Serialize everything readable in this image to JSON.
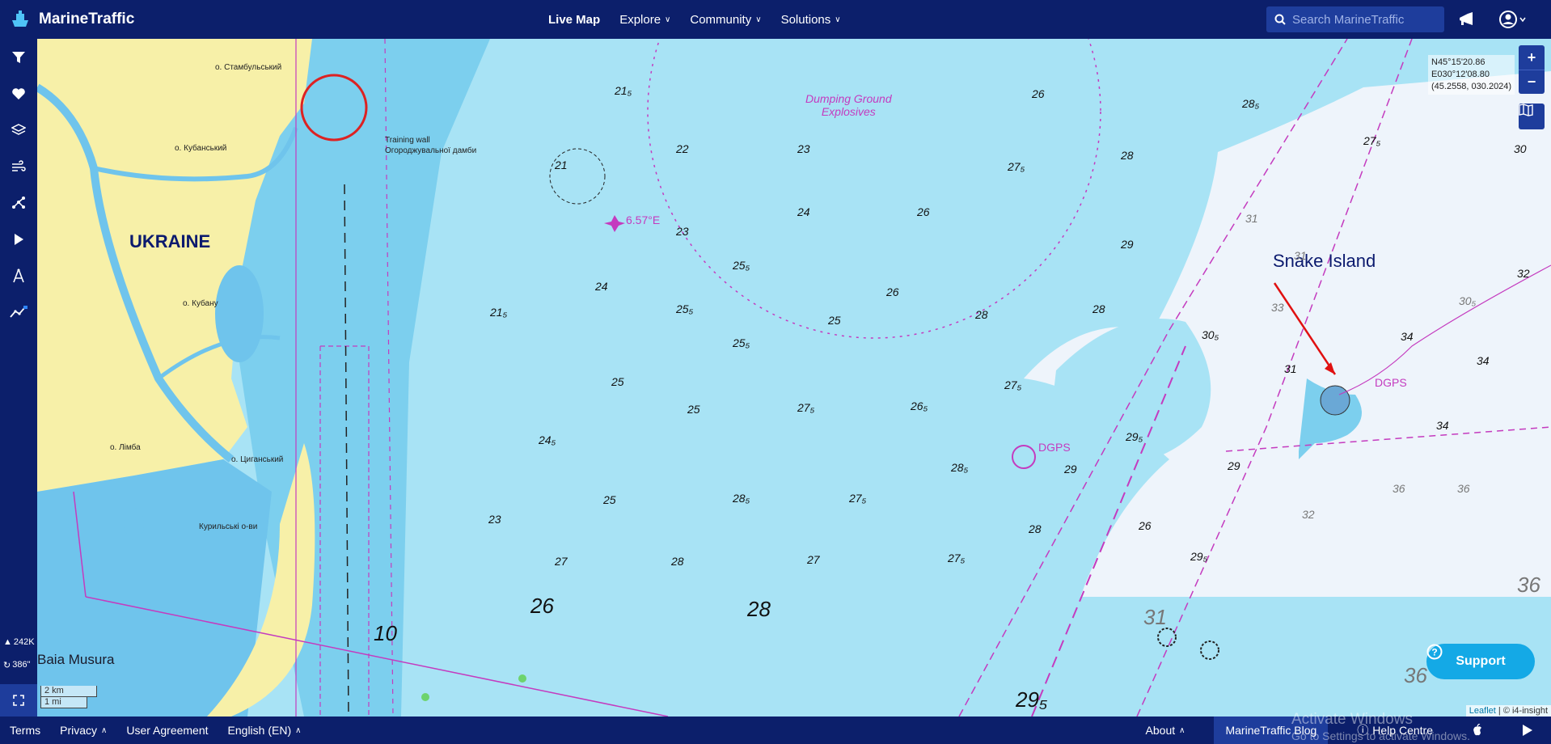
{
  "header": {
    "brand": "MarineTraffic",
    "nav": [
      {
        "label": "Live Map",
        "active": true,
        "dropdown": false
      },
      {
        "label": "Explore",
        "active": false,
        "dropdown": true
      },
      {
        "label": "Community",
        "active": false,
        "dropdown": true
      },
      {
        "label": "Solutions",
        "active": false,
        "dropdown": true
      }
    ],
    "search_placeholder": "Search MarineTraffic",
    "icons": [
      "megaphone-icon",
      "user-account-icon"
    ]
  },
  "sidebar": {
    "items": [
      "filter-icon",
      "favorites-heart-icon",
      "layers-icon",
      "wind-icon",
      "routes-icon",
      "play-icon",
      "measure-icon",
      "analytics-icon"
    ],
    "vessel_count": "242K",
    "refresh_interval": "386\""
  },
  "map": {
    "coords_line1": "N45°15'20.86",
    "coords_line2": "E030°12'08.80",
    "coords_line3": "(45.2558, 030.2024)",
    "zoom_in": "+",
    "zoom_out": "−",
    "labels": {
      "country": "UKRAINE",
      "island": "Snake Island",
      "baia": "Baia Musura",
      "dumping": "Dumping Ground\nExplosives",
      "magvar": "6.57°E",
      "dgps": "DGPS"
    },
    "places": [
      {
        "text": "о. Стамбульський"
      },
      {
        "text": "о. Кубанський"
      },
      {
        "text": "о. Кубану"
      },
      {
        "text": "о. Лімба"
      },
      {
        "text": "о. Циганський"
      },
      {
        "text": "Курильські о-ви"
      },
      {
        "text": "Training wall"
      },
      {
        "text": "Огороджувальної дамби"
      }
    ],
    "scale_km": "2 km",
    "scale_mi": "1 mi",
    "attribution": [
      "Leaflet",
      "© i4-insight"
    ]
  },
  "support_label": "Support",
  "footer": {
    "left": [
      "Terms",
      "Privacy",
      "User Agreement",
      "English (EN)"
    ],
    "right": [
      "About",
      "MarineTraffic Blog",
      "Help Centre"
    ]
  },
  "watermark": {
    "title": "Activate Windows",
    "subtitle": "Go to Settings to activate Windows."
  }
}
